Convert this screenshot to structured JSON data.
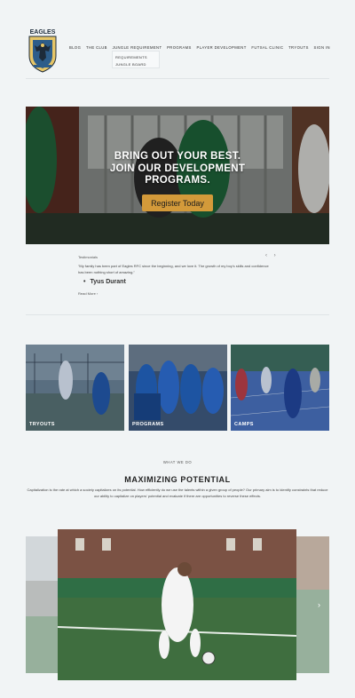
{
  "header": {
    "logo_text": "EAGLES",
    "nav": [
      "BLOG",
      "THE CLUB",
      "JUNGLE REQUIREMENT",
      "PROGRAMS",
      "PLAYER DEVELOPMENT",
      "FUTSAL CLINIC",
      "TRYOUTS",
      "SIGN IN"
    ],
    "dropdown": [
      "REQUIREMENTS",
      "JUNGLE BOARD"
    ]
  },
  "hero": {
    "headline_1": "BRING OUT YOUR BEST.",
    "headline_2": "JOIN OUR DEVELOPMENT",
    "headline_3": "PROGRAMS.",
    "cta": "Register Today"
  },
  "testimonials": {
    "label": "Testimonials",
    "quote": "\"My family has been part of Eagles RFC since the beginning, and we love it. The growth of my boy's skills and confidence has been nothing short of amazing.\"",
    "author": "Tyus Durant",
    "read_more": "Read More",
    "prev": "‹",
    "next": "›"
  },
  "cards": [
    {
      "label": "TRYOUTS"
    },
    {
      "label": "PROGRAMS"
    },
    {
      "label": "CAMPS"
    }
  ],
  "what_we_do": {
    "eyebrow": "WHAT WE DO",
    "title": "MAXIMIZING POTENTIAL",
    "body": "Capitalization is the rate at which a society capitalizes on its potential. How efficiently do we use the talents within a given group of people? Our primary aim is to identify constraints that reduce our ability to capitalize on players' potential and evaluate if there are opportunities to reverse these effects."
  },
  "carousel": {
    "next": "›"
  },
  "colors": {
    "accent": "#d39a3a",
    "background": "#f1f4f5"
  }
}
